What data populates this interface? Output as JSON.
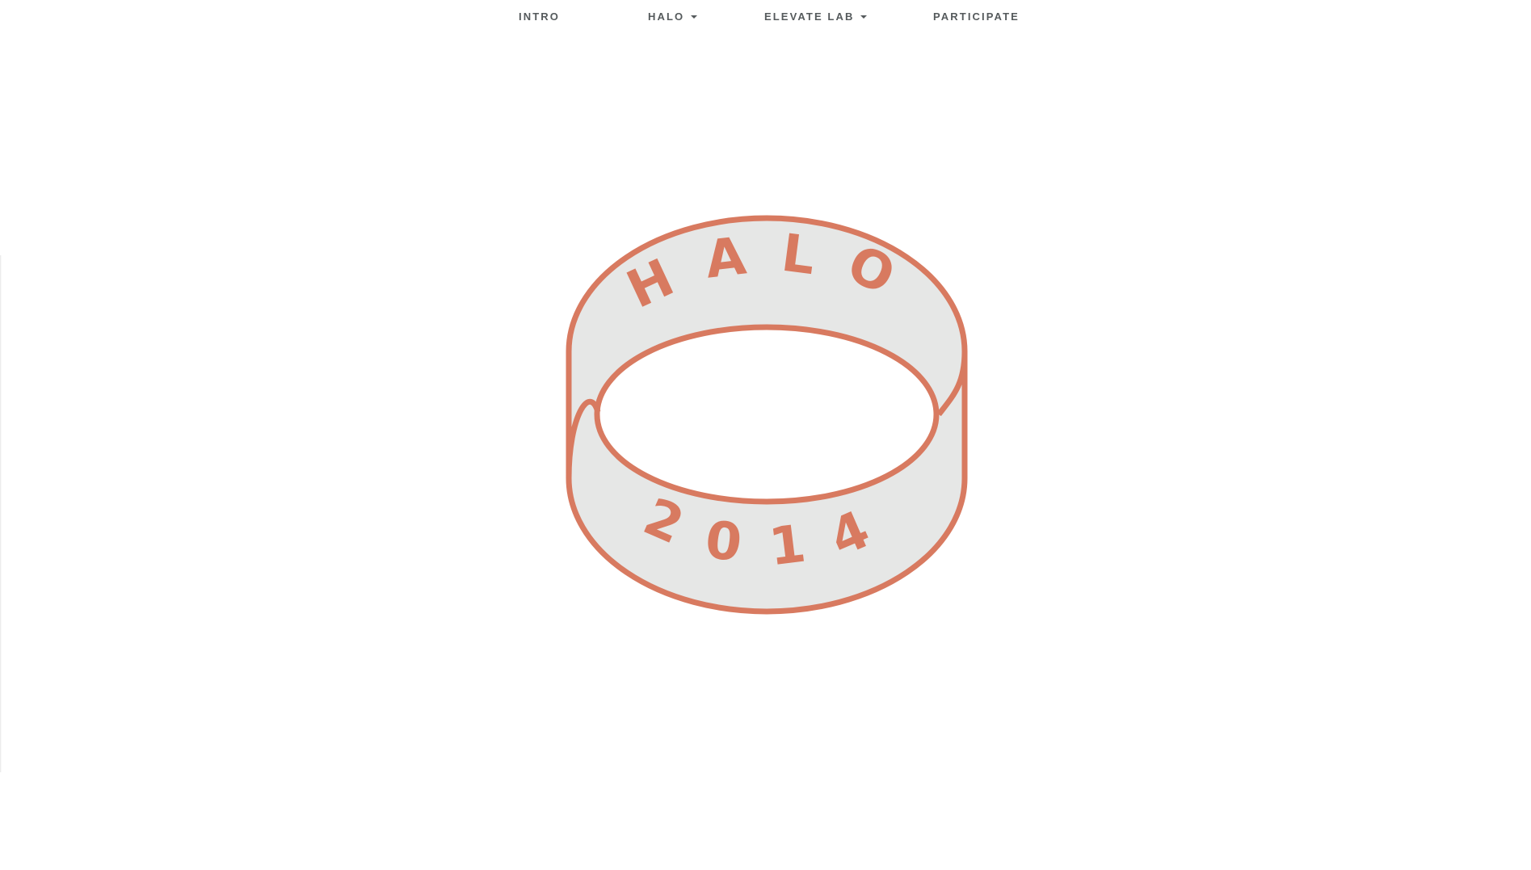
{
  "nav": {
    "items": [
      {
        "label": "INTRO",
        "has_dropdown": false
      },
      {
        "label": "HALO",
        "has_dropdown": true
      },
      {
        "label": "ELEVATE LAB",
        "has_dropdown": true
      },
      {
        "label": "PARTICIPATE",
        "has_dropdown": false
      }
    ]
  },
  "logo": {
    "top_text": "HALO",
    "bottom_text": "2014",
    "colors": {
      "stroke": "#d87a60",
      "fill": "#e6e7e6",
      "text": "#d87a60"
    }
  },
  "colors": {
    "background": "#ffffff",
    "nav_text": "#555a5c",
    "accent": "#d87a60"
  }
}
